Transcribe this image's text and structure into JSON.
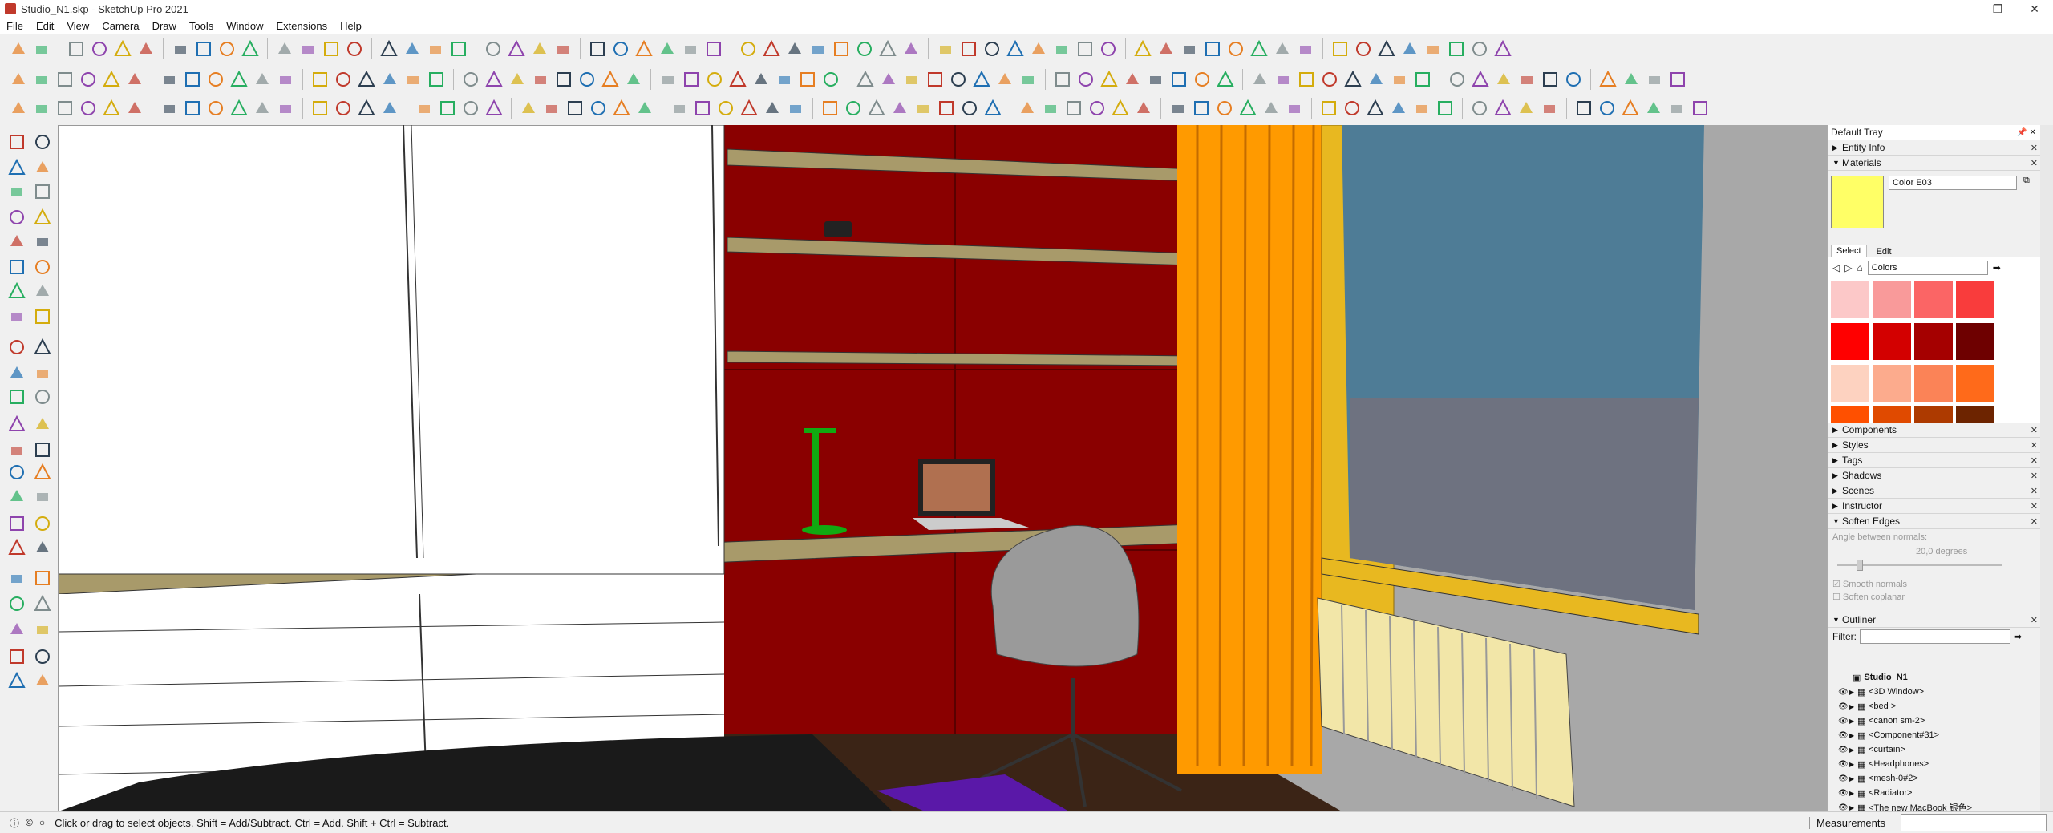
{
  "window": {
    "title": "Studio_N1.skp - SketchUp Pro 2021",
    "minimize": "—",
    "maximize": "❐",
    "close": "✕"
  },
  "menu": [
    "File",
    "Edit",
    "View",
    "Camera",
    "Draw",
    "Tools",
    "Window",
    "Extensions",
    "Help"
  ],
  "tray": {
    "title": "Default Tray",
    "panels_top": [
      {
        "label": "Entity Info",
        "expanded": false
      },
      {
        "label": "Materials",
        "expanded": true
      }
    ],
    "materials": {
      "current_name": "Color E03",
      "current_color": "#ffff66",
      "tabs": [
        "Select",
        "Edit"
      ],
      "library": "Colors",
      "swatches": [
        "#fcc8c8",
        "#f99a9a",
        "#fb6565",
        "#f93c3c",
        "#ff0000",
        "#d30000",
        "#a50000",
        "#6e0000",
        "#fdd2c0",
        "#fcab8d",
        "#fb8357",
        "#ff6a1a",
        "#ff5000",
        "#e04a00",
        "#ad3a00",
        "#6d2400"
      ]
    },
    "panels_mid": [
      {
        "label": "Components"
      },
      {
        "label": "Styles"
      },
      {
        "label": "Tags"
      },
      {
        "label": "Shadows"
      },
      {
        "label": "Scenes"
      },
      {
        "label": "Instructor"
      },
      {
        "label": "Soften Edges"
      }
    ],
    "soften": {
      "angle_label": "Angle between normals:",
      "angle_value": "20,0  degrees",
      "smooth": "Smooth normals",
      "coplanar": "Soften coplanar"
    },
    "outliner": {
      "title": "Outliner",
      "filter_label": "Filter:",
      "root": "Studio_N1",
      "items": [
        "<3D Window>",
        "<bed >",
        "<canon sm-2>",
        "<Component#31>",
        "<curtain>",
        "<Headphones>",
        "<mesh-0#2>",
        "<Radiator>",
        "<The new MacBook 银色>"
      ]
    }
  },
  "status": {
    "message": "Click or drag to select objects. Shift = Add/Subtract. Ctrl = Add. Shift + Ctrl = Subtract.",
    "measurements_label": "Measurements"
  },
  "colors": {
    "wall_red": "#8a0000",
    "curtain_orange": "#ff9a00",
    "sky": "#4e7c96",
    "wardrobe": "#ffffff",
    "shelf": "#a89a6a",
    "floor": "#3b2416"
  }
}
